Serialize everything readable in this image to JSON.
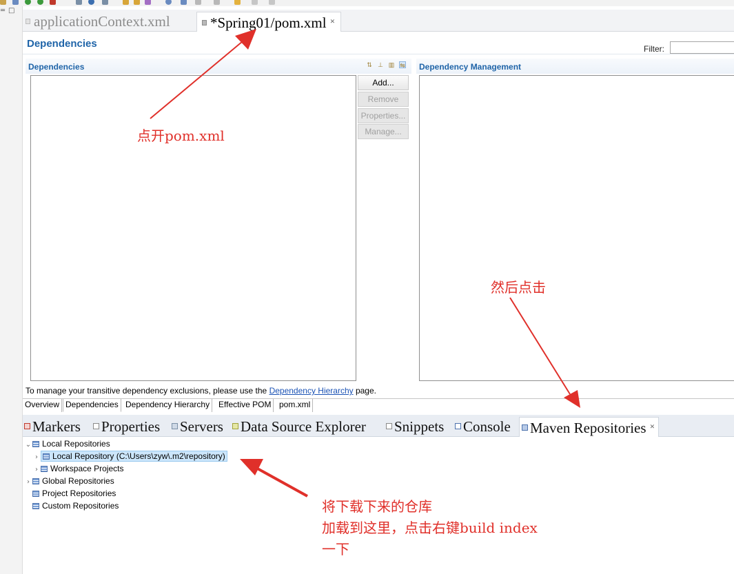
{
  "editor": {
    "tabs": [
      {
        "label": "applicationContext.xml",
        "active": false
      },
      {
        "label": "*Spring01/pom.xml",
        "active": true
      }
    ]
  },
  "page": {
    "title": "Dependencies",
    "filter_label": "Filter:",
    "filter_value": ""
  },
  "dependencies": {
    "title": "Dependencies",
    "buttons": [
      {
        "label": "Add...",
        "enabled": true
      },
      {
        "label": "Remove",
        "enabled": false
      },
      {
        "label": "Properties...",
        "enabled": false
      },
      {
        "label": "Manage...",
        "enabled": false
      }
    ]
  },
  "dependency_management": {
    "title": "Dependency Management"
  },
  "hint": {
    "before": "To manage your transitive dependency exclusions, please use the ",
    "link": "Dependency Hierarchy",
    "after": " page."
  },
  "page_tabs": [
    "Overview",
    "Dependencies",
    "Dependency Hierarchy",
    "Effective POM",
    "pom.xml"
  ],
  "page_tabs_active": "Dependencies",
  "view_tabs": [
    {
      "label": "Markers",
      "icon": "markers-icon",
      "color": "#c0392b"
    },
    {
      "label": "Properties",
      "icon": "properties-icon",
      "color": "#8a8a8a"
    },
    {
      "label": "Servers",
      "icon": "servers-icon",
      "color": "#7a8fa6"
    },
    {
      "label": "Data Source Explorer",
      "icon": "data-source-icon",
      "color": "#a1a33a"
    },
    {
      "label": "Snippets",
      "icon": "snippets-icon",
      "color": "#8a8a8a"
    },
    {
      "label": "Console",
      "icon": "console-icon",
      "color": "#4d72ad"
    },
    {
      "label": "Maven Repositories",
      "icon": "maven-repositories-icon",
      "color": "#4d72ad",
      "active": true
    }
  ],
  "tree": [
    {
      "label": "Local Repositories",
      "twisty": "expanded"
    },
    {
      "label": "Local Repository (C:\\Users\\zyw\\.m2\\repository)",
      "twisty": "collapsed",
      "selected": true
    },
    {
      "label": "Workspace Projects",
      "twisty": "collapsed"
    },
    {
      "label": "Global Repositories",
      "twisty": "collapsed"
    },
    {
      "label": "Project Repositories",
      "twisty": "none"
    },
    {
      "label": "Custom Repositories",
      "twisty": "none"
    }
  ],
  "annotations": {
    "open_pom": "点开pom.xml",
    "then_click": "然后点击",
    "load_repo_line1": "将下载下来的仓库",
    "load_repo_line2": "加载到这里，点击右键build index",
    "load_repo_line3": "一下"
  },
  "colors": {
    "accent": "#1f64a8",
    "annotation": "#e0302a",
    "selection": "#cce6fb"
  }
}
